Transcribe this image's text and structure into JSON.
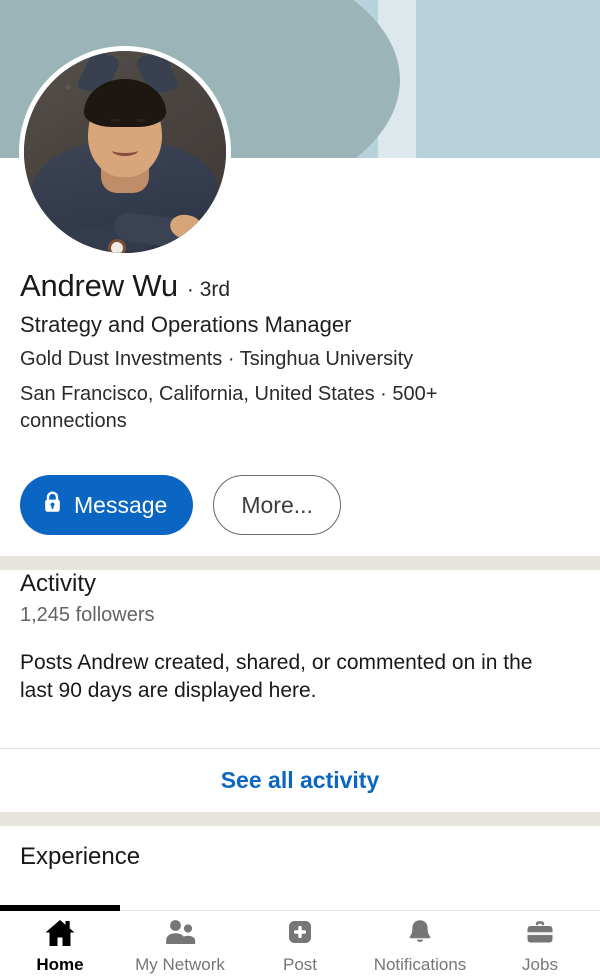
{
  "banner": {
    "dark_color": "#9ab4b8",
    "pale_band_color": "#dde8ec",
    "light_color": "#b7d2da"
  },
  "profile": {
    "avatar_alt": "Andrew Wu profile photo",
    "name": "Andrew Wu",
    "degree": "· 3rd",
    "headline": "Strategy and Operations Manager",
    "affiliation": "Gold Dust Investments · Tsinghua University",
    "location": "San Francisco, California, United States ·",
    "connections": "500+ connections"
  },
  "actions": {
    "message_label": "Message",
    "more_label": "More...",
    "primary_color": "#0a66c2"
  },
  "activity": {
    "title": "Activity",
    "followers": "1,245 followers",
    "description": "Posts Andrew created, shared, or commented on in the last 90 days are displayed here.",
    "see_all_label": "See all activity",
    "link_color": "#0a66c2"
  },
  "experience": {
    "title": "Experience"
  },
  "nav": {
    "items": [
      {
        "label": "Home",
        "icon": "home-icon",
        "active": true
      },
      {
        "label": "My Network",
        "icon": "people-icon",
        "active": false
      },
      {
        "label": "Post",
        "icon": "plus-square-icon",
        "active": false
      },
      {
        "label": "Notifications",
        "icon": "bell-icon",
        "active": false
      },
      {
        "label": "Jobs",
        "icon": "briefcase-icon",
        "active": false
      }
    ]
  }
}
